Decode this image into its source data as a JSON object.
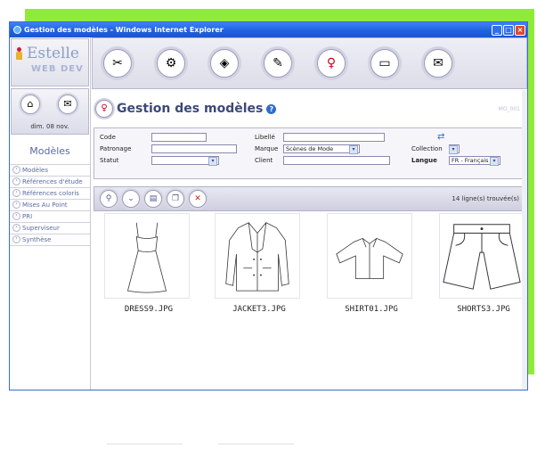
{
  "window": {
    "title": "Gestion des modèles - Windows Internet Explorer"
  },
  "brand": {
    "name": "Estelle",
    "subtitle": "WEB DEV"
  },
  "date": "dim. 08 nov.",
  "sidebar": {
    "title": "Modèles",
    "items": [
      {
        "label": "Modèles"
      },
      {
        "label": "Références d'étude"
      },
      {
        "label": "Références coloris"
      },
      {
        "label": "Mises Au Point"
      },
      {
        "label": "PRI"
      },
      {
        "label": "Superviseur"
      },
      {
        "label": "Synthèse"
      }
    ]
  },
  "toolbar": {
    "icons": [
      "sewing-kit-icon",
      "gear-box-icon",
      "fabric-icon",
      "pencil-palette-icon",
      "dress-figure-icon",
      "folder-icon",
      "envelope-icon"
    ]
  },
  "page": {
    "title": "Gestion des modèles",
    "code": "MO_001"
  },
  "form": {
    "code_label": "Code",
    "code_value": "",
    "patronage_label": "Patronage",
    "patronage_value": "",
    "statut_label": "Statut",
    "statut_value": "",
    "libelle_label": "Libellé",
    "libelle_value": "",
    "marque_label": "Marque",
    "marque_value": "Scènes de Mode",
    "client_label": "Client",
    "client_value": "",
    "collection_label": "Collection",
    "collection_value": "",
    "langue_label": "Langue",
    "langue_value": "FR - Français"
  },
  "results": {
    "count": "14 ligne(s) trouvée(s)"
  },
  "gallery": [
    {
      "caption": "DRESS9.JPG"
    },
    {
      "caption": "JACKET3.JPG"
    },
    {
      "caption": "SHIRT01.JPG"
    },
    {
      "caption": "SHORTS3.JPG"
    }
  ],
  "colors": {
    "accent_green": "#8fea3a",
    "title_blue": "#3c4a78",
    "titlebar": "#1f5fe0"
  }
}
